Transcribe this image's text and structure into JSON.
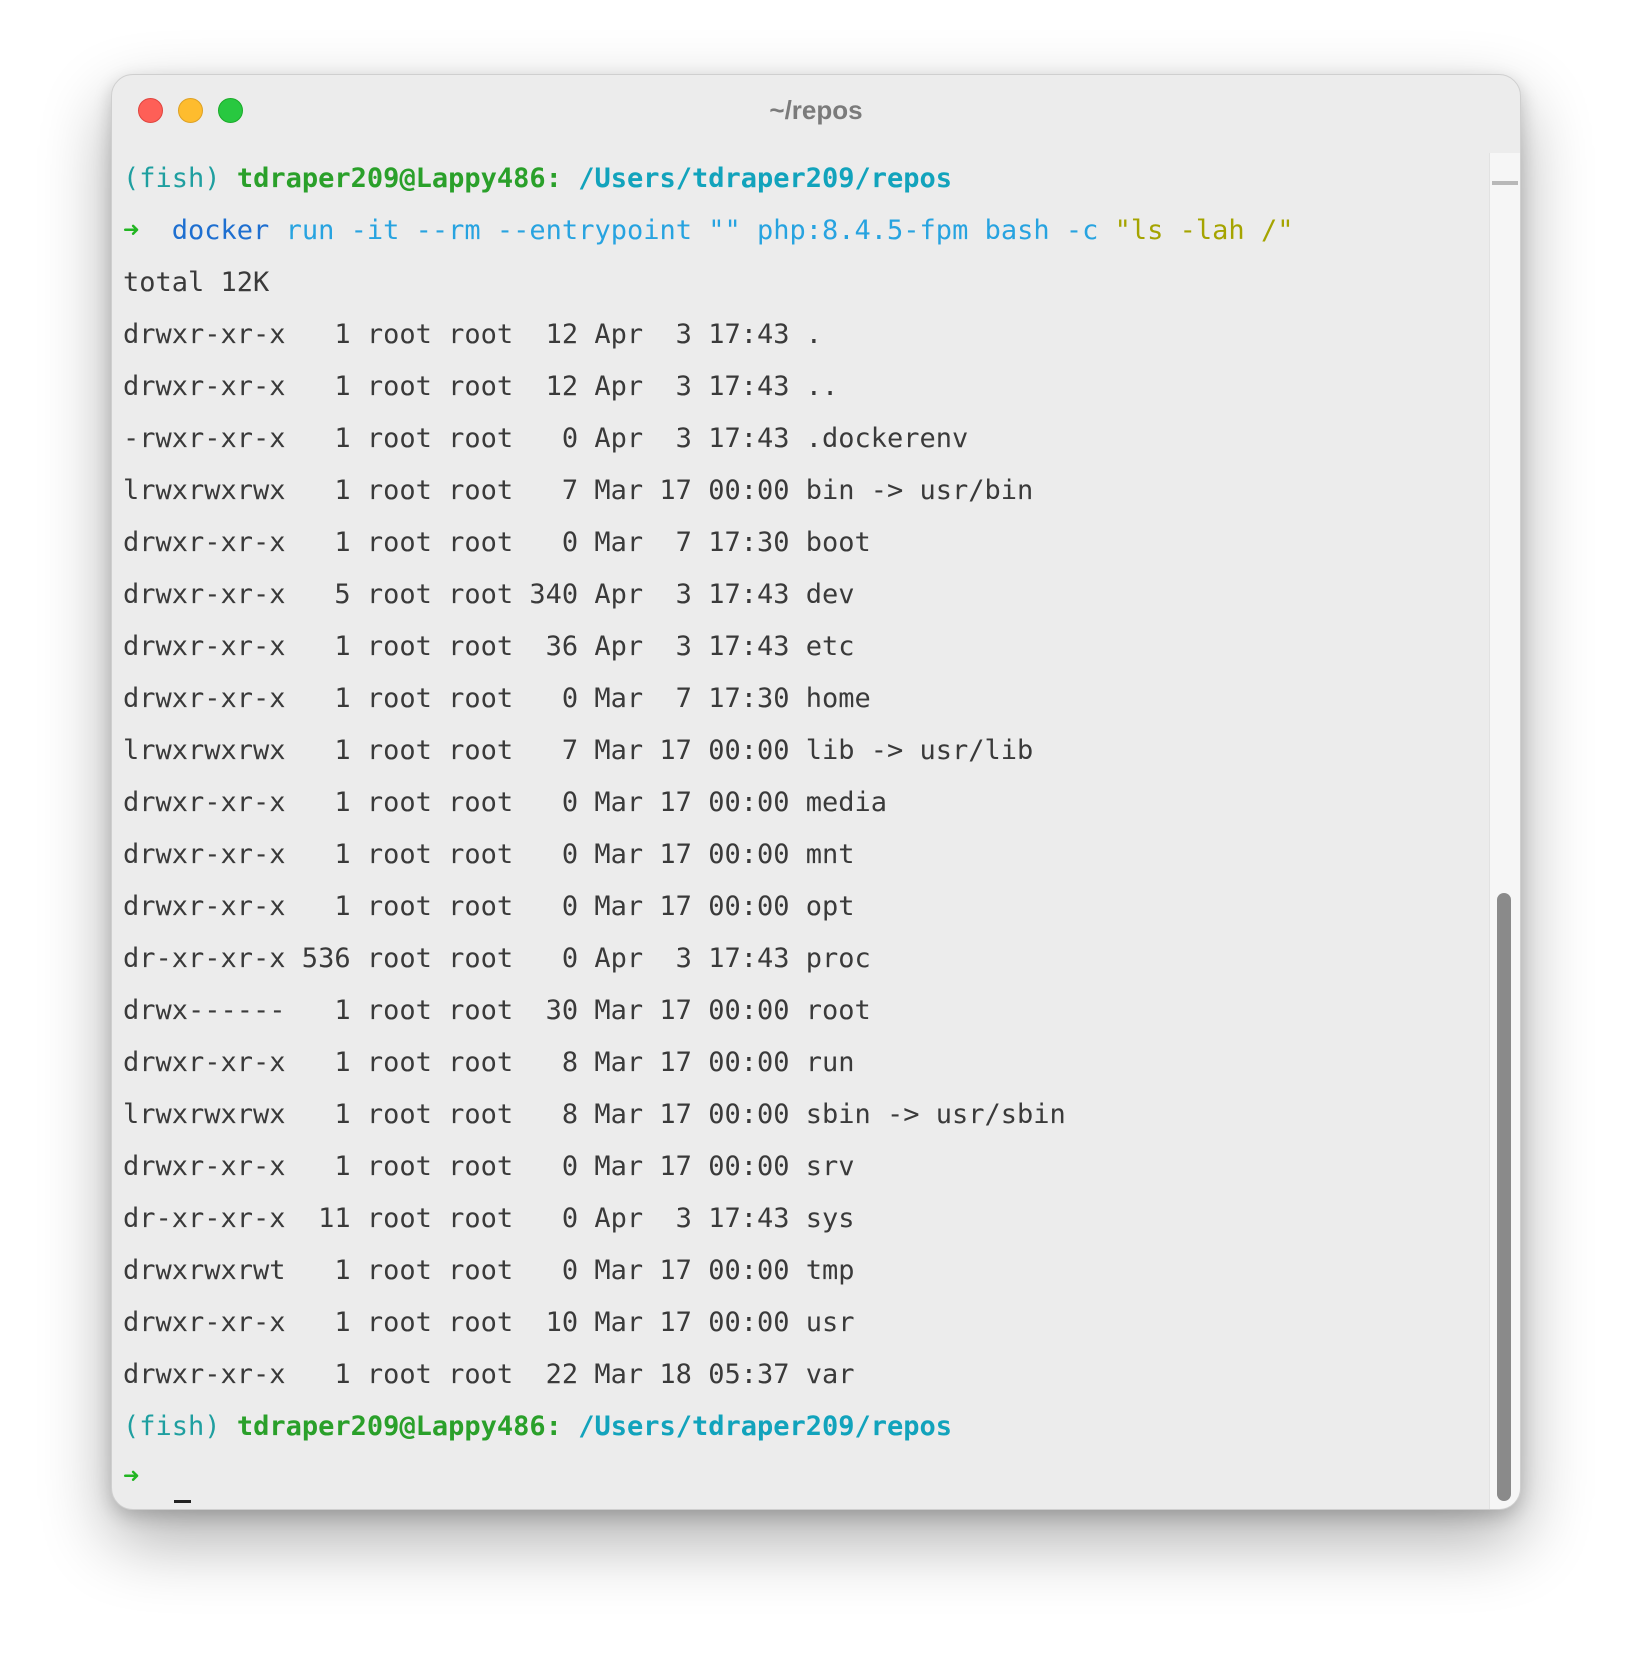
{
  "window": {
    "title": "~/repos"
  },
  "prompt": {
    "shell": "(fish)",
    "user_host": "tdraper209@Lappy486:",
    "path": "/Users/tdraper209/repos",
    "arrow": "➜"
  },
  "command": {
    "program": "docker",
    "args": "run -it --rm --entrypoint \"\" php:8.4.5-fpm bash -c",
    "quoted": "\"ls -lah /\""
  },
  "output": {
    "total": "total 12K",
    "lines": [
      "drwxr-xr-x   1 root root  12 Apr  3 17:43 .",
      "drwxr-xr-x   1 root root  12 Apr  3 17:43 ..",
      "-rwxr-xr-x   1 root root   0 Apr  3 17:43 .dockerenv",
      "lrwxrwxrwx   1 root root   7 Mar 17 00:00 bin -> usr/bin",
      "drwxr-xr-x   1 root root   0 Mar  7 17:30 boot",
      "drwxr-xr-x   5 root root 340 Apr  3 17:43 dev",
      "drwxr-xr-x   1 root root  36 Apr  3 17:43 etc",
      "drwxr-xr-x   1 root root   0 Mar  7 17:30 home",
      "lrwxrwxrwx   1 root root   7 Mar 17 00:00 lib -> usr/lib",
      "drwxr-xr-x   1 root root   0 Mar 17 00:00 media",
      "drwxr-xr-x   1 root root   0 Mar 17 00:00 mnt",
      "drwxr-xr-x   1 root root   0 Mar 17 00:00 opt",
      "dr-xr-xr-x 536 root root   0 Apr  3 17:43 proc",
      "drwx------   1 root root  30 Mar 17 00:00 root",
      "drwxr-xr-x   1 root root   8 Mar 17 00:00 run",
      "lrwxrwxrwx   1 root root   8 Mar 17 00:00 sbin -> usr/sbin",
      "drwxr-xr-x   1 root root   0 Mar 17 00:00 srv",
      "dr-xr-xr-x  11 root root   0 Apr  3 17:43 sys",
      "drwxrwxrwt   1 root root   0 Mar 17 00:00 tmp",
      "drwxr-xr-x   1 root root  10 Mar 17 00:00 usr",
      "drwxr-xr-x   1 root root  22 Mar 18 05:37 var"
    ]
  },
  "colors": {
    "close": "#fe5f57",
    "minimize": "#febc2e",
    "zoom": "#28c840",
    "user_host": "#2aa02a",
    "path": "#12a3bc",
    "command": "#1e6fd0",
    "string": "#a5a400"
  },
  "icons": {
    "prompt_arrow": "arrow-right-icon"
  }
}
